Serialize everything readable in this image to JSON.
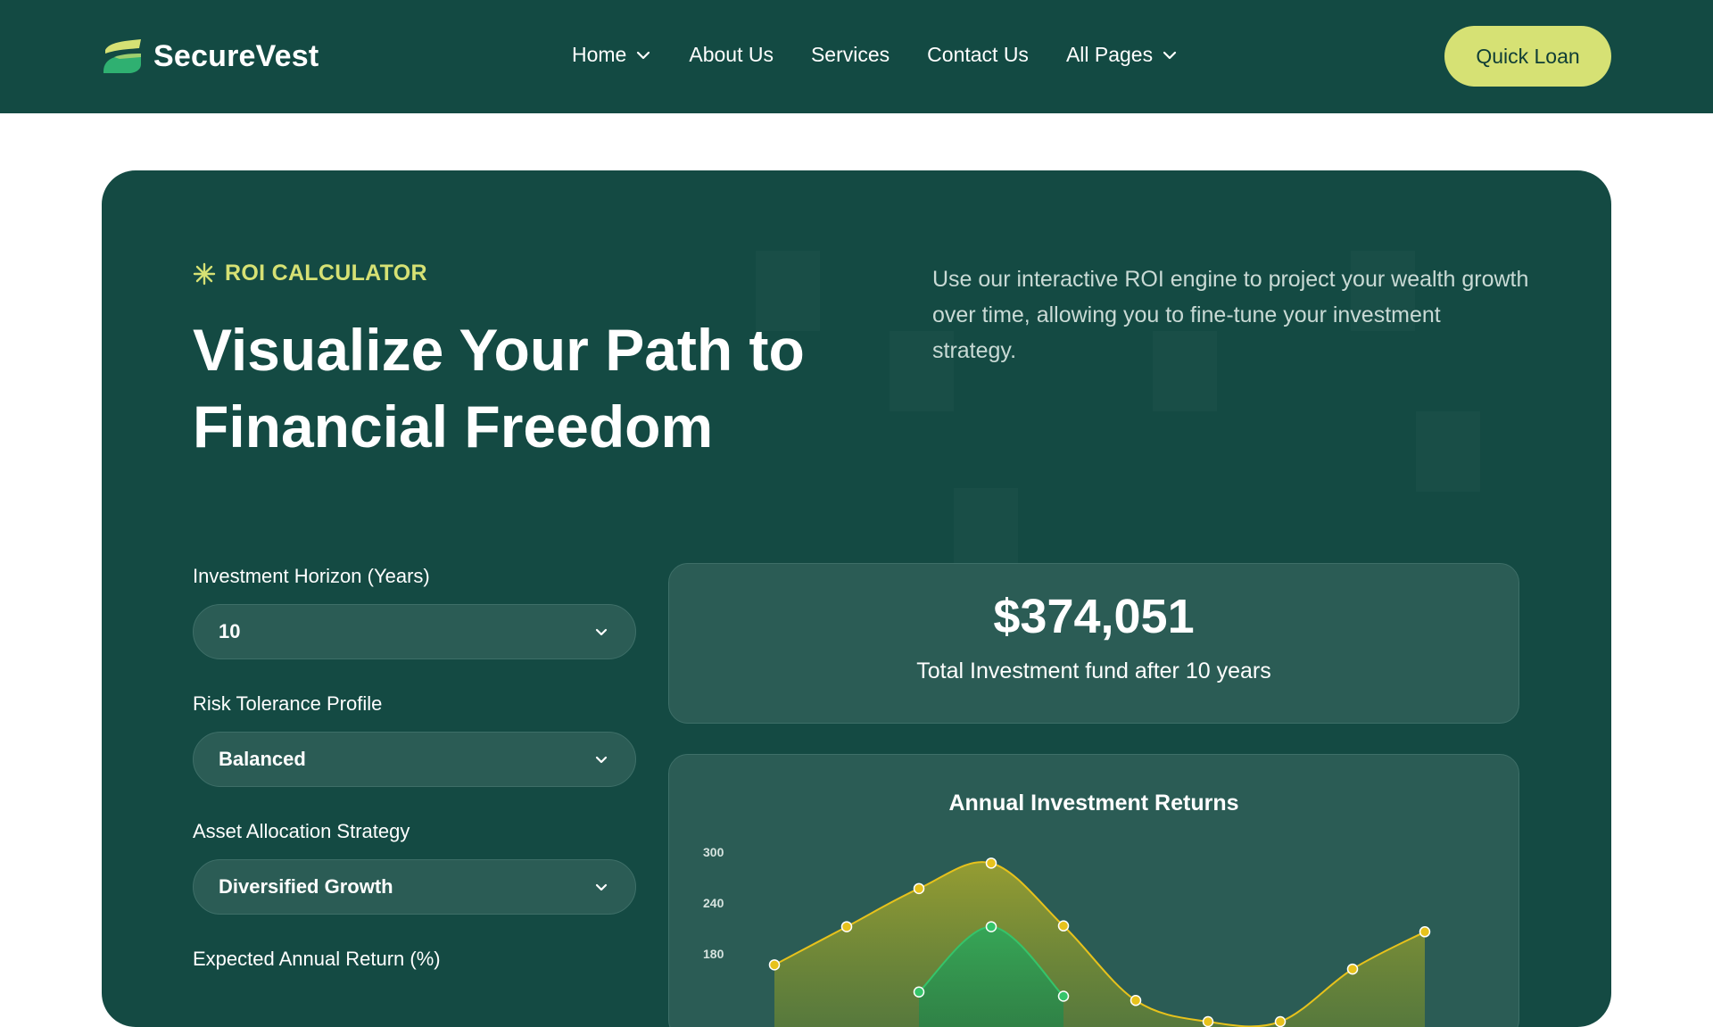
{
  "brand": {
    "name": "SecureVest",
    "logo_icon": "leaf-logo-icon"
  },
  "nav": {
    "items": [
      {
        "label": "Home",
        "has_dropdown": true
      },
      {
        "label": "About Us",
        "has_dropdown": false
      },
      {
        "label": "Services",
        "has_dropdown": false
      },
      {
        "label": "Contact Us",
        "has_dropdown": false
      },
      {
        "label": "All Pages",
        "has_dropdown": true
      }
    ],
    "cta_label": "Quick Loan"
  },
  "hero": {
    "eyebrow": "ROI CALCULATOR",
    "eyebrow_icon": "asterisk-icon",
    "title_line1": "Visualize Your Path to",
    "title_line2": "Financial Freedom",
    "description": "Use our interactive ROI engine to project your wealth growth over time, allowing you to fine-tune your investment strategy."
  },
  "form": {
    "horizon": {
      "label": "Investment Horizon (Years)",
      "value": "10"
    },
    "risk": {
      "label": "Risk Tolerance Profile",
      "value": "Balanced"
    },
    "allocation": {
      "label": "Asset Allocation Strategy",
      "value": "Diversified Growth"
    },
    "expected_return": {
      "label": "Expected Annual Return (%)"
    }
  },
  "result": {
    "amount": "$374,051",
    "caption": "Total Investment fund after 10 years"
  },
  "colors": {
    "primary": "#134a43",
    "accent": "#d6e174",
    "card": "#2b5c55",
    "series_gold": "#e7c21c",
    "series_green": "#35c46a"
  },
  "chart_data": {
    "type": "area",
    "title": "Annual Investment Returns",
    "y_ticks": [
      "300",
      "240",
      "180"
    ],
    "series": [
      {
        "points": [
          [
            1,
            167
          ],
          [
            2,
            212
          ],
          [
            3,
            257
          ],
          [
            4,
            287
          ],
          [
            5,
            213
          ],
          [
            6,
            125
          ],
          [
            7,
            100
          ],
          [
            8,
            100
          ],
          [
            9,
            162
          ],
          [
            10,
            206
          ]
        ]
      },
      {
        "points": [
          [
            3,
            135
          ],
          [
            4,
            212
          ],
          [
            5,
            130
          ]
        ]
      }
    ]
  }
}
